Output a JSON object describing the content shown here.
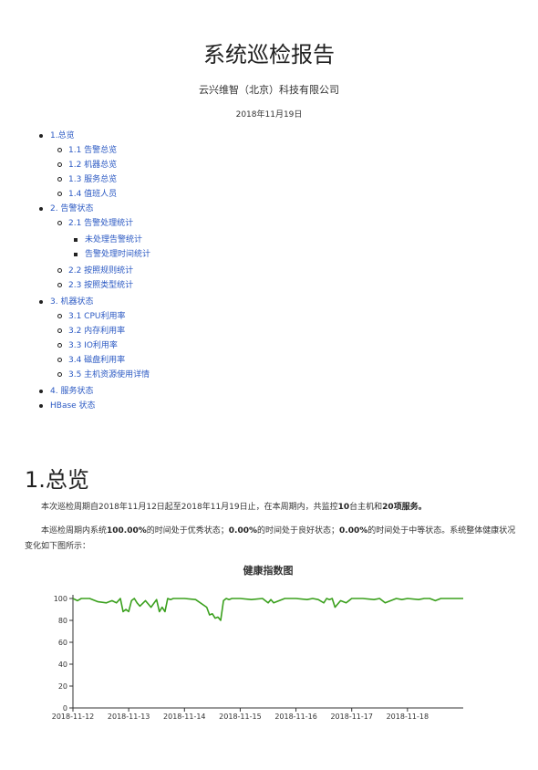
{
  "report": {
    "title": "系统巡检报告",
    "company": "云兴维智（北京）科技有限公司",
    "date": "2018年11月19日"
  },
  "toc": [
    {
      "label": "1.总览",
      "children": [
        {
          "label": "1.1 告警总览"
        },
        {
          "label": "1.2 机器总览"
        },
        {
          "label": "1.3 服务总览"
        },
        {
          "label": "1.4 值班人员"
        }
      ]
    },
    {
      "label": "2. 告警状态",
      "children": [
        {
          "label": "2.1 告警处理统计",
          "children": [
            {
              "label": "未处理告警统计"
            },
            {
              "label": "告警处理时间统计"
            }
          ]
        },
        {
          "label": "2.2 按照规则统计"
        },
        {
          "label": "2.3 按照类型统计"
        }
      ]
    },
    {
      "label": "3. 机器状态",
      "children": [
        {
          "label": "3.1 CPU利用率"
        },
        {
          "label": "3.2 内存利用率"
        },
        {
          "label": "3.3 IO利用率"
        },
        {
          "label": "3.4 磁盘利用率"
        },
        {
          "label": "3.5 主机资源使用详情"
        }
      ]
    },
    {
      "label": "4. 服务状态",
      "children": []
    },
    {
      "label": "HBase 状态",
      "children": []
    }
  ],
  "section1": {
    "heading": "1.总览",
    "para1": {
      "t1": "本次巡检周期自2018年11月12日起至2018年11月19日止，在本周期内，共监控",
      "hosts": "10",
      "t2": "台主机和",
      "services": "20",
      "t3": "项服务。"
    },
    "para2": {
      "t1": "本巡检周期内系统",
      "excellent": "100.00%",
      "t2": "的时间处于优秀状态；",
      "good": "0.00%",
      "t3": "的时间处于良好状态；",
      "medium": "0.00%",
      "t4": "的时间处于中等状态。系统整体健康状况变化如下图所示："
    }
  },
  "chart_data": {
    "type": "line",
    "title": "健康指数图",
    "xlabel": "",
    "ylabel": "",
    "ylim": [
      0,
      100
    ],
    "yticks": [
      0,
      20,
      40,
      60,
      80,
      100
    ],
    "xticks": [
      "2018-11-12",
      "2018-11-13",
      "2018-11-14",
      "2018-11-15",
      "2018-11-16",
      "2018-11-17",
      "2018-11-18"
    ],
    "x_range": [
      0,
      7
    ],
    "grid": false,
    "line_color": "#3aa01d",
    "series": [
      {
        "x": [
          0,
          0.08,
          0.15,
          0.3,
          0.45,
          0.6,
          0.7,
          0.78,
          0.85,
          0.9,
          0.95,
          1.0,
          1.05,
          1.1,
          1.15,
          1.2,
          1.3,
          1.4,
          1.5,
          1.55,
          1.6,
          1.65,
          1.7,
          1.75,
          1.8,
          1.85,
          1.9,
          2.0,
          2.2,
          2.4,
          2.45,
          2.5,
          2.55,
          2.6,
          2.65,
          2.7,
          2.75,
          2.8,
          2.85,
          2.9,
          3.0,
          3.2,
          3.4,
          3.5,
          3.55,
          3.6,
          3.7,
          3.8,
          4.0,
          4.2,
          4.3,
          4.4,
          4.5,
          4.55,
          4.6,
          4.65,
          4.7,
          4.8,
          4.9,
          5.0,
          5.2,
          5.4,
          5.5,
          5.6,
          5.7,
          5.8,
          5.9,
          6.0,
          6.2,
          6.3,
          6.4,
          6.5,
          6.6,
          6.8,
          7.0
        ],
        "y": [
          100,
          98,
          100,
          100,
          97,
          96,
          98,
          96,
          100,
          88,
          90,
          88,
          98,
          100,
          96,
          93,
          98,
          92,
          99,
          88,
          92,
          88,
          100,
          99,
          100,
          100,
          100,
          100,
          99,
          92,
          85,
          86,
          82,
          83,
          80,
          98,
          100,
          99,
          100,
          100,
          100,
          99,
          100,
          96,
          99,
          96,
          98,
          100,
          100,
          99,
          100,
          99,
          96,
          100,
          99,
          100,
          92,
          98,
          96,
          100,
          100,
          99,
          100,
          96,
          98,
          100,
          99,
          100,
          99,
          100,
          100,
          98,
          100,
          100,
          100
        ]
      }
    ]
  }
}
